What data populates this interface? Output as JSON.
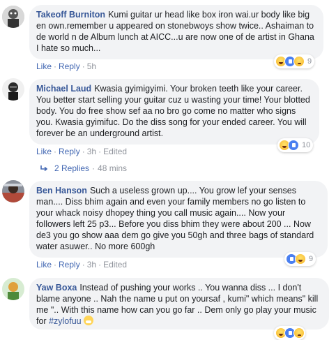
{
  "comments": [
    {
      "author": "Takeoff Burniton",
      "text": "Kumi guitar ur head like box iron wai.ur body like big en own.remember u appeared on stonebwoys show twice.. Ashaiman to de world n de Album lunch at AICC...u are now one of de artist in Ghana I hate so much...",
      "like": "Like",
      "reply": "Reply",
      "time": "5h",
      "edited": "",
      "reactions": [
        "haha",
        "like",
        "sad"
      ],
      "reaction_count": "9"
    },
    {
      "author": "Michael Laud",
      "text": "Kwasia gyimigyimi. Your broken teeth like your career. You better start selling your guitar cuz u wasting your time! Your blotted body. You do free show sef aa no bro go come no matter who signs you. Kwasia gyimifuc. Do the diss song for your ended career. You will forever be an underground artist.",
      "like": "Like",
      "reply": "Reply",
      "time": "3h",
      "edited": "Edited",
      "reactions": [
        "haha",
        "like"
      ],
      "reaction_count": "10",
      "replies_label": "2 Replies",
      "replies_time": "48 mins"
    },
    {
      "author": "Ben Hanson",
      "text": "Such a useless grown up.... You grow lef your senses man.... Diss bhim again and even your family members no go listen to your whack noisy dhopey thing you call music again.... Now your followers left 25 p3... Before you diss bhim they were about 200 ... Now de3 you go show aaa dem go give you 50gh and three bags of standard water asuwer.. No more 600gh",
      "like": "Like",
      "reply": "Reply",
      "time": "3h",
      "edited": "Edited",
      "reactions": [
        "like",
        "haha"
      ],
      "reaction_count": "9"
    },
    {
      "author": "Yaw Boxa",
      "text": "Instead of pushing your works .. You wanna diss ... I don't blame anyone .. Nah the name u put on yoursaf , kumi\" which means\" kill me \".. With this name how can you go far .. Dem only go play your music for ",
      "hashtag": "#zylofuu",
      "reactions": [
        "haha",
        "like",
        "sad"
      ]
    }
  ],
  "ui": {
    "dot": "·",
    "accent": "#385898",
    "link": "#4267b2",
    "bubble_bg": "#f2f3f5"
  }
}
